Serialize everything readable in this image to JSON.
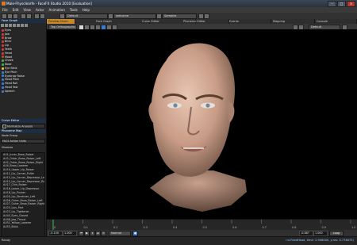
{
  "window": {
    "title": "Male-Fhysclearfe - FaceFX Studio 2010 [Evaluation]"
  },
  "menu": [
    "File",
    "Edit",
    "View",
    "Actor",
    "Animation",
    "Tools",
    "Help"
  ],
  "toolbar": {
    "group_combo": "Default",
    "anim_combo": "welcome",
    "dropdown_combo": "Samples"
  },
  "left_panel": {
    "title": "Face Graph",
    "layers": [
      {
        "label": "Eyes",
        "color": "#d23a3a"
      },
      {
        "label": "Jaw",
        "color": "#d23a3a"
      },
      {
        "label": "Brow",
        "color": "#d23a3a"
      },
      {
        "label": "Blink",
        "color": "#d23a3a"
      },
      {
        "label": "Lip",
        "color": "#d23a3a"
      },
      {
        "label": "Teeth",
        "color": "#d23a3a"
      },
      {
        "label": "Head",
        "color": "#d23a3a"
      },
      {
        "label": "Mood",
        "color": "#d23a3a"
      },
      {
        "label": "Cheek",
        "color": "#3fae48"
      },
      {
        "label": "Nose",
        "color": "#3fae48"
      },
      {
        "label": "Eye Blink",
        "color": "#d9c12a"
      },
      {
        "label": "Eye Pitch",
        "color": "#3a7bd5"
      },
      {
        "label": "Eyebrow Raise",
        "color": "#3a7bd5"
      },
      {
        "label": "Head Pitch",
        "color": "#3a7bd5"
      },
      {
        "label": "Head Roll",
        "color": "#3a7bd5"
      },
      {
        "label": "Head Yaw",
        "color": "#3a7bd5"
      },
      {
        "label": "Speech",
        "color": "#3a7bd5"
      }
    ],
    "curve_editor_label": "Curve Editor",
    "normalize_label": "Normalize Analysis",
    "phoneme_label": "Phoneme Map",
    "node_group_label": "Node Group",
    "node_group_value": "FACS Action Units",
    "visemes_label": "Visemes",
    "visemes": [
      "AU1_Inner_Brow_Raiser",
      "AU2_Outer_Brow_Raiser_Left",
      "AU2_Outer_Brow_Raiser_Right",
      "AU4_Brow_Lowerer",
      "AU10_Upper_Lip_Raiser",
      "AU12_Lip_Corner_Puller",
      "AU15_Lip_Corner_Depressor_Left",
      "AU15_Lip_Corner_Depressor_Right",
      "AU17_Chin_Raiser",
      "AU16_Lower_Lip_Depressor",
      "AU18_Lip_Pucker",
      "AU20_Lip_Stretcher_Left",
      "AU26_Outer_Brow_Raiser_Left",
      "AU27_Outer_Brow_Raiser_Right",
      "AU25_Lips_Part",
      "AU23_Lip_Tightener",
      "AU45_Eyes_Closed",
      "AU46_Jaw_Thrust",
      "AU51_Yellow_Lowerer",
      "AU53_Blink"
    ]
  },
  "tabs": [
    {
      "label": "Preview Chain",
      "active": true
    },
    {
      "label": "Face Graph",
      "active": false
    },
    {
      "label": "Curve Editor",
      "active": false
    },
    {
      "label": "Phoneme Editor",
      "active": false
    },
    {
      "label": "Events",
      "active": false
    },
    {
      "label": "Mapping",
      "active": false
    },
    {
      "label": "Console",
      "active": false
    }
  ],
  "viewport": {
    "camera_combo": "Top Orthographic",
    "right_combo": "Default"
  },
  "timeline": {
    "start_value": "-0.100",
    "end_value": "1.000",
    "ticks": [
      "0",
      "0.1",
      "0.2",
      "0.3",
      "0.4",
      "0.5",
      "0.6",
      "0.7",
      "0.8",
      "0.9",
      "1.0"
    ],
    "speed_combo": "Normal",
    "right_start": "-0.887",
    "right_end": "1.000",
    "loop_label": "Loop"
  },
  "status": {
    "left_text": "Ready",
    "right_text": "r:x:FeedHead, time: 2.908000, y:res: 0.778075)"
  }
}
